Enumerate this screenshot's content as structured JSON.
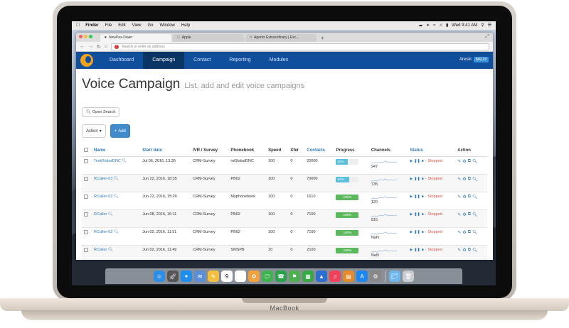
{
  "laptop": {
    "brand": "MacBook"
  },
  "menubar": {
    "items": [
      "Finder",
      "File",
      "Edit",
      "View",
      "Go",
      "Window",
      "Help"
    ],
    "clock": "Wed 9:41 AM"
  },
  "browser": {
    "tabs": [
      {
        "label": "NewPax-Dialer",
        "active": true
      },
      {
        "label": "Apple",
        "active": false
      },
      {
        "label": "Agents Extraordinary | Exc...",
        "active": false
      }
    ],
    "url_placeholder": "Search or enter an address"
  },
  "app": {
    "nav": [
      "Dashboard",
      "Campaign",
      "Contact",
      "Reporting",
      "Modules"
    ],
    "active_nav": "Campaign",
    "user": "Areski",
    "balance": "$49.23",
    "title": "Voice Campaign",
    "subtitle": "List, add and edit voice campaigns",
    "open_search": "Open Search",
    "action_label": "Action",
    "add_label": "Add",
    "columns": [
      "Name",
      "Start date",
      "IVR / Survey",
      "Phonebook",
      "Speed",
      "Xfer",
      "Contacts",
      "Progress",
      "Channels",
      "Status",
      "Action"
    ],
    "rows": [
      {
        "name": "TestGlobalDNC",
        "start": "Jul 06, 2016, 13:35",
        "ivr": "CRM-Survey",
        "phonebook": "mGlobalDNC",
        "speed": "100",
        "xfer": "0",
        "contacts": "20000",
        "progress": "52%",
        "progress_value": 52,
        "channels": "947",
        "status": "Stopped"
      },
      {
        "name": "RCaller-03",
        "start": "Jun 22, 2016, 18:35",
        "ivr": "CRM-Survey",
        "phonebook": "PB02",
        "speed": "100",
        "xfer": "0",
        "contacts": "70000",
        "progress": "57%",
        "progress_value": 57,
        "channels": "735",
        "status": "Stopped"
      },
      {
        "name": "RCaller-02",
        "start": "Jun 22, 2016, 15:26",
        "ivr": "CRM-Survey",
        "phonebook": "Myphonebook",
        "speed": "100",
        "xfer": "0",
        "contacts": "1610",
        "progress": "100%",
        "progress_value": 100,
        "channels": "120",
        "status": "Stopped"
      },
      {
        "name": "RCaller",
        "start": "Jun 08, 2016, 16:11",
        "ivr": "CRM-Survey",
        "phonebook": "PB02",
        "speed": "100",
        "xfer": "0",
        "contacts": "7100",
        "progress": "100%",
        "progress_value": 100,
        "channels": "815",
        "status": "Stopped"
      },
      {
        "name": "RCaller-02",
        "start": "Jun 02, 2016, 11:51",
        "ivr": "CRM-Survey",
        "phonebook": "PB02",
        "speed": "100",
        "xfer": "0",
        "contacts": "7100",
        "progress": "100%",
        "progress_value": 100,
        "channels": "NaN",
        "status": "Stopped"
      },
      {
        "name": "RCaller",
        "start": "Jun 02, 2016, 11:49",
        "ivr": "CRM-Survey",
        "phonebook": "SMSPB",
        "speed": "10",
        "xfer": "0",
        "contacts": "2100",
        "progress": "100%",
        "progress_value": 100,
        "channels": "NaN",
        "status": "Stopped"
      }
    ]
  },
  "dock": {
    "icons": [
      "finder-icon",
      "launchpad-icon",
      "safari-icon",
      "mail-icon",
      "notes-icon",
      "calendar-icon",
      "reminders-icon",
      "photos-icon",
      "messages-icon",
      "facetime-icon",
      "maps-icon",
      "numbers-icon",
      "keynote-icon",
      "music-icon",
      "books-icon",
      "appstore-icon",
      "settings-icon",
      "folder-icon",
      "trash-icon"
    ],
    "calendar_day": "9"
  }
}
